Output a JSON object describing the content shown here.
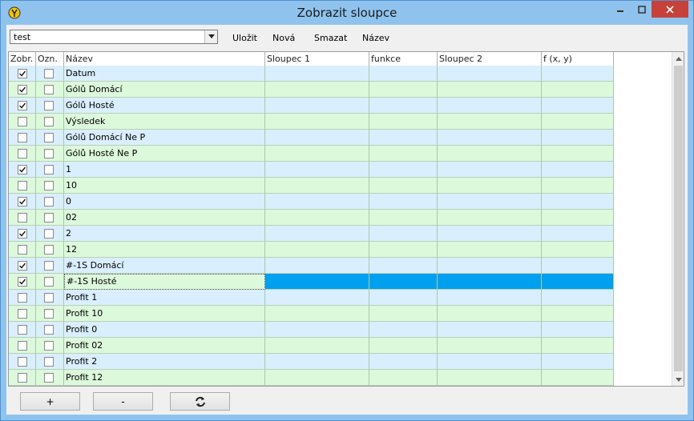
{
  "window": {
    "title": "Zobrazit sloupce"
  },
  "toolbar": {
    "combo_value": "test",
    "buttons": {
      "save": "Uložit",
      "new": "Nová",
      "delete": "Smazat",
      "name": "Název"
    }
  },
  "grid": {
    "headers": {
      "show": "Zobr.",
      "mark": "Ozn.",
      "name": "Název",
      "col1": "Sloupec 1",
      "func": "funkce",
      "col2": "Sloupec 2",
      "fxy": "f (x, y)"
    },
    "rows": [
      {
        "name": "Datum",
        "show": true,
        "mark": false
      },
      {
        "name": "Gólů Domácí",
        "show": true,
        "mark": false
      },
      {
        "name": "Gólů Hosté",
        "show": true,
        "mark": false
      },
      {
        "name": "Výsledek",
        "show": false,
        "mark": false
      },
      {
        "name": "Gólů Domácí Ne P",
        "show": false,
        "mark": false
      },
      {
        "name": "Gólů Hosté Ne P",
        "show": false,
        "mark": false
      },
      {
        "name": "1",
        "show": true,
        "mark": false
      },
      {
        "name": "10",
        "show": false,
        "mark": false
      },
      {
        "name": "0",
        "show": true,
        "mark": false
      },
      {
        "name": "02",
        "show": false,
        "mark": false
      },
      {
        "name": "2",
        "show": true,
        "mark": false
      },
      {
        "name": "12",
        "show": false,
        "mark": false
      },
      {
        "name": "#-1S Domácí",
        "show": true,
        "mark": false
      },
      {
        "name": "#-1S Hosté",
        "show": true,
        "mark": false,
        "selected": true
      },
      {
        "name": "Profit 1",
        "show": false,
        "mark": false
      },
      {
        "name": "Profit 10",
        "show": false,
        "mark": false
      },
      {
        "name": "Profit 0",
        "show": false,
        "mark": false
      },
      {
        "name": "Profit 02",
        "show": false,
        "mark": false
      },
      {
        "name": "Profit 2",
        "show": false,
        "mark": false
      },
      {
        "name": "Profit 12",
        "show": false,
        "mark": false
      }
    ]
  },
  "bottom": {
    "add": "+",
    "remove": "-",
    "refresh_icon": "refresh-icon"
  },
  "colors": {
    "row_blue": "#d9efff",
    "row_green": "#dcf9dc",
    "selected": "#00a0f0"
  }
}
